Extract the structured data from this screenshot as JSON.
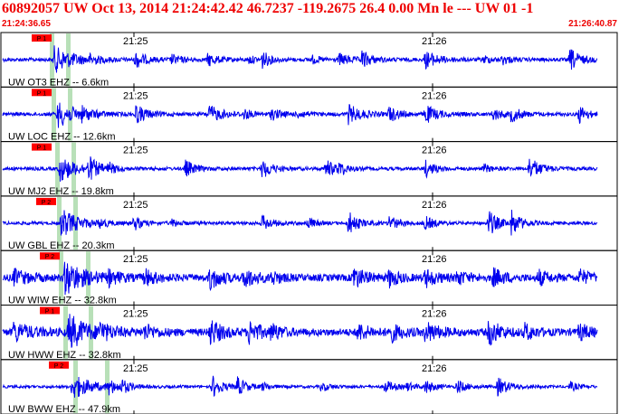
{
  "header": {
    "title": "60892057 UW Oct 13, 2014 21:24:42.42   46.7237 -119.2675 26.4 0.00 Mn le --- UW 01   -1",
    "time_start": "21:24:36.65",
    "time_end": "21:26:40.87"
  },
  "colors": {
    "trace": "#0000ee",
    "pick_flag": "#ff0000",
    "pick_band": "#b8e0b8",
    "header_text": "#ee0000",
    "panel_border": "#000000"
  },
  "chart_data": {
    "type": "line",
    "title": "",
    "xlabel": "",
    "ylabel": "",
    "time_range": [
      "21:24:36.65",
      "21:26:40.87"
    ],
    "time_ticks": [
      "21:25",
      "21:26"
    ],
    "grid": false,
    "series": [
      {
        "station": "UW OT3 EHZ -- 6.6km",
        "pick": "P 1"
      },
      {
        "station": "UW LOC EHZ -- 12.6km",
        "pick": "P 1"
      },
      {
        "station": "UW MJ2 EHZ -- 19.8km",
        "pick": "P 1"
      },
      {
        "station": "UW GBL EHZ -- 20.3km",
        "pick": "P 2"
      },
      {
        "station": "UW WIW EHZ -- 32.8km",
        "pick": "P 2"
      },
      {
        "station": "UW HWW EHZ -- 32.8km",
        "pick": "P 1"
      },
      {
        "station": "UW BWW EHZ -- 47.9km",
        "pick": "P 2"
      }
    ]
  }
}
